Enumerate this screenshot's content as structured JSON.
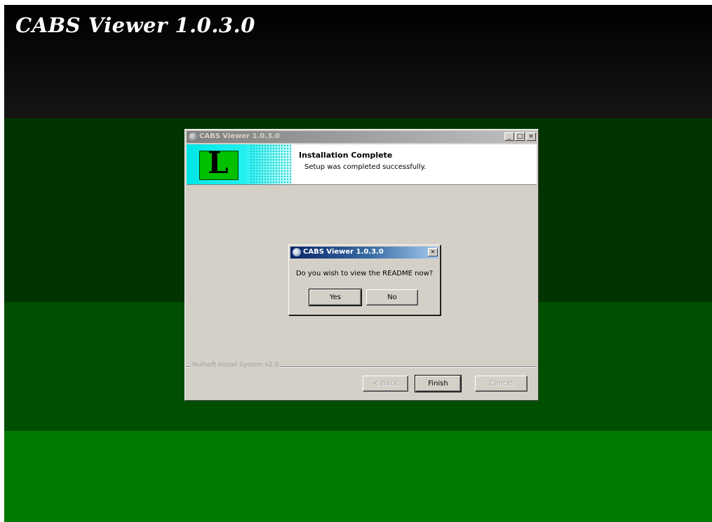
{
  "background": {
    "title": "CABS Viewer 1.0.3.0"
  },
  "installer": {
    "window_title": "CABS Viewer 1.0.3.0",
    "header_logo_letter": "L",
    "header_title": "Installation Complete",
    "header_subtitle": "Setup was completed successfully.",
    "branding": "Nullsoft Install System v2.0",
    "buttons": {
      "back": "< Back",
      "finish": "Finish",
      "cancel": "Cancel"
    },
    "controls": {
      "minimize": "_",
      "maximize": "□",
      "close": "×"
    }
  },
  "dialog": {
    "title": "CABS Viewer 1.0.3.0",
    "message": "Do you wish to view the README now?",
    "yes": "Yes",
    "no": "No",
    "close": "×"
  }
}
